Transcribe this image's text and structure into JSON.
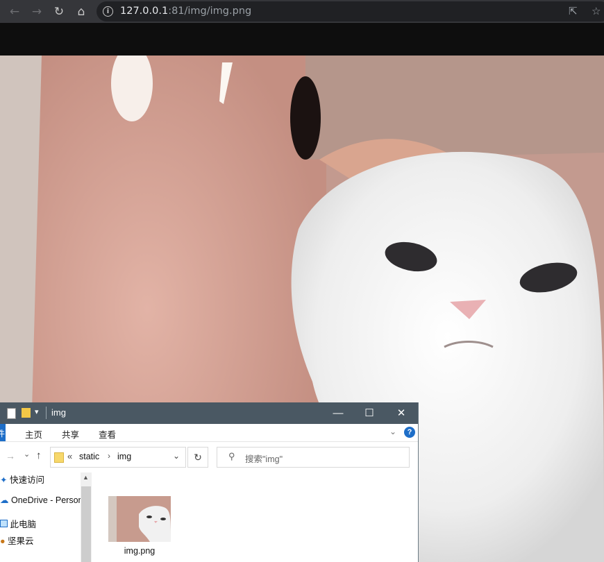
{
  "browser": {
    "url_host": "127.0.0.1",
    "url_rest": ":81/img/img.png"
  },
  "explorer": {
    "title": "img",
    "ribbon_tabs": [
      "主页",
      "共享",
      "查看"
    ],
    "file_tab": "件",
    "breadcrumb": [
      "static",
      "img"
    ],
    "search_placeholder": "搜索\"img\"",
    "nav_items": [
      "快速访问",
      "OneDrive - Persor",
      "此电脑",
      "坚果云"
    ],
    "file_name": "img.png"
  }
}
